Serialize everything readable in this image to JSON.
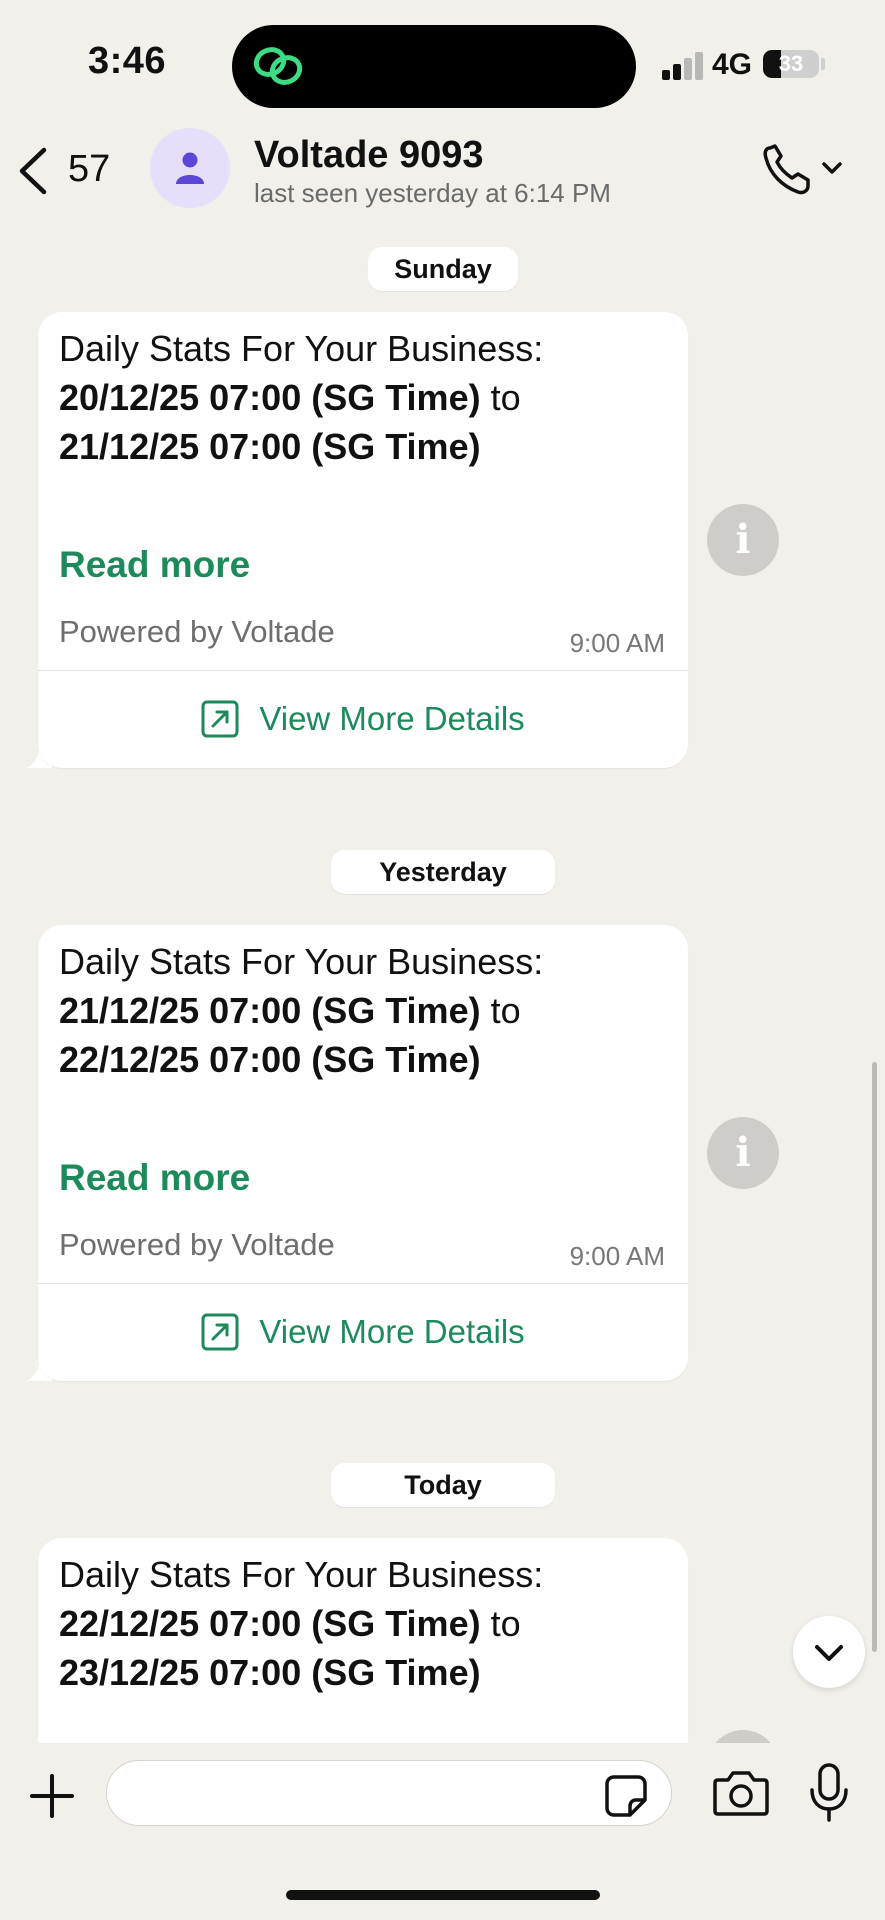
{
  "status_bar": {
    "time": "3:46",
    "carrier": "4G",
    "battery": "33",
    "battery_level": 0.33
  },
  "header": {
    "back_count": "57",
    "contact_name": "Voltade 9093",
    "contact_status": "last seen yesterday at 6:14 PM",
    "back_icon": "chevron-left-icon",
    "avatar_icon": "person-icon",
    "call_icon": "phone-icon"
  },
  "messages": [
    {
      "date": "Sunday",
      "intro": "Daily Stats For Your Business:",
      "from": "20/12/25 07:00 (SG Time)",
      "to_word": "to",
      "until": "21/12/25 07:00 (SG Time)",
      "read_more": "Read more",
      "footer": "Powered by Voltade",
      "time": "9:00 AM",
      "action": "View More Details"
    },
    {
      "date": "Yesterday",
      "intro": "Daily Stats For Your Business:",
      "from": "21/12/25 07:00 (SG Time)",
      "to_word": "to",
      "until": "22/12/25 07:00 (SG Time)",
      "read_more": "Read more",
      "footer": "Powered by Voltade",
      "time": "9:00 AM",
      "action": "View More Details"
    },
    {
      "date": "Today",
      "intro": "Daily Stats For Your Business:",
      "from": "22/12/25 07:00 (SG Time)",
      "to_word": "to",
      "until": "23/12/25 07:00 (SG Time)"
    }
  ],
  "info_label": "i",
  "composer": {
    "placeholder": "",
    "icons": [
      "plus-icon",
      "sticker-icon",
      "camera-icon",
      "microphone-icon"
    ]
  },
  "colors": {
    "background": "#f2f0eb",
    "accent_green": "#1c8a5a",
    "bubble": "#ffffff",
    "avatar_bg": "#e6defa",
    "avatar_fg": "#5b46d6"
  }
}
